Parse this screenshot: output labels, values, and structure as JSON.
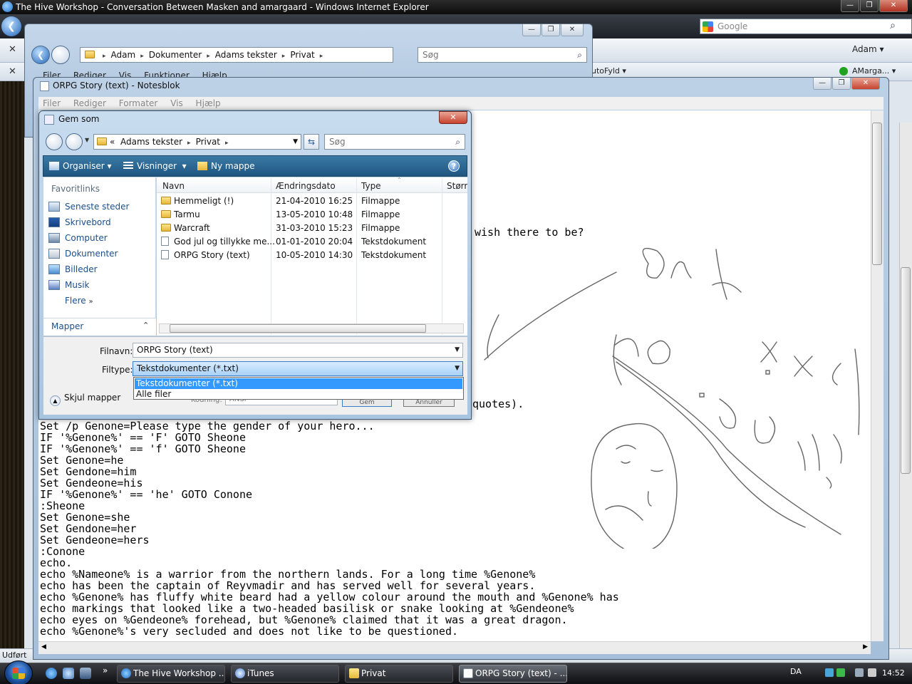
{
  "ie": {
    "title": "The Hive Workshop - Conversation Between Masken and amargaard - Windows Internet Explorer",
    "search_placeholder": "Google",
    "user_menu": "Adam",
    "autofill": "utoFyld",
    "account": "AMarga...",
    "status": "Udført"
  },
  "explorer": {
    "breadcrumb": [
      "Adam",
      "Dokumenter",
      "Adams tekster",
      "Privat"
    ],
    "search_placeholder": "Søg",
    "menu": [
      "Filer",
      "Rediger",
      "Vis",
      "Funktioner",
      "Hjælp"
    ]
  },
  "notepad": {
    "title": "ORPG Story (text) - Notesblok",
    "menu": [
      "Filer",
      "Rediger",
      "Formater",
      "Vis",
      "Hjælp"
    ],
    "partial_line_1": "wish there to be?",
    "partial_line_2": "quotes).",
    "lines": [
      "Set /p Genone=Please type the gender of your hero...",
      "IF '%Genone%' == 'F' GOTO Sheone",
      "IF '%Genone%' == 'f' GOTO Sheone",
      "Set Genone=he",
      "Set Gendone=him",
      "Set Gendeone=his",
      "IF '%Genone%' == 'he' GOTO Conone",
      ":Sheone",
      "Set Genone=she",
      "Set Gendone=her",
      "Set Gendeone=hers",
      ":Conone",
      "echo.",
      "echo %Nameone% is a warrior from the northern lands. For a long time %Genone%",
      "echo has been the captain of Reyvmadir and has served well for several years.",
      "echo %Genone% has fluffy white beard had a yellow colour around the mouth and %Genone% has",
      "echo markings that looked like a two-headed basilisk or snake looking at %Gendeone%",
      "echo eyes on %Gendeone% forehead, but %Genone% claimed that it was a great dragon.",
      "echo %Genone%'s very secluded and does not like to be questioned."
    ]
  },
  "dialog": {
    "title": "Gem som",
    "breadcrumb_prefix": "«",
    "breadcrumb": [
      "Adams tekster",
      "Privat"
    ],
    "search_placeholder": "Søg",
    "toolbar": {
      "organize": "Organiser",
      "views": "Visninger",
      "new_folder": "Ny mappe"
    },
    "favorites_header": "Favoritlinks",
    "favorites": [
      "Seneste steder",
      "Skrivebord",
      "Computer",
      "Dokumenter",
      "Billeder",
      "Musik"
    ],
    "more": "Flere",
    "folders": "Mapper",
    "columns": [
      "Navn",
      "Ændringsdato",
      "Type",
      "Større"
    ],
    "files": [
      {
        "name": "Hemmeligt (!)",
        "date": "21-04-2010 16:25",
        "type": "Filmappe",
        "kind": "folder"
      },
      {
        "name": "Tarmu",
        "date": "13-05-2010 10:48",
        "type": "Filmappe",
        "kind": "folder"
      },
      {
        "name": "Warcraft",
        "date": "31-03-2010 15:23",
        "type": "Filmappe",
        "kind": "folder"
      },
      {
        "name": "God jul og tillykke me...",
        "date": "01-01-2010 20:04",
        "type": "Tekstdokument",
        "kind": "doc"
      },
      {
        "name": "ORPG Story (text)",
        "date": "10-05-2010 14:30",
        "type": "Tekstdokument",
        "kind": "doc"
      }
    ],
    "filename_label": "Filnavn:",
    "filename_value": "ORPG Story (text)",
    "filetype_label": "Filtype:",
    "filetype_value": "Tekstdokumenter (*.txt)",
    "filetype_options": [
      "Tekstdokumenter (*.txt)",
      "Alle filer"
    ],
    "hide_folders": "Skjul mapper",
    "encoding_label": "Kodning:",
    "encoding_value": "ANSI",
    "save_button": "Gem",
    "cancel_button": "Annuller"
  },
  "taskbar": {
    "tasks": [
      "The Hive Workshop ...",
      "iTunes",
      "Privat",
      "ORPG Story (text) - ..."
    ],
    "active_task": 3,
    "language": "DA",
    "clock": "14:52"
  }
}
